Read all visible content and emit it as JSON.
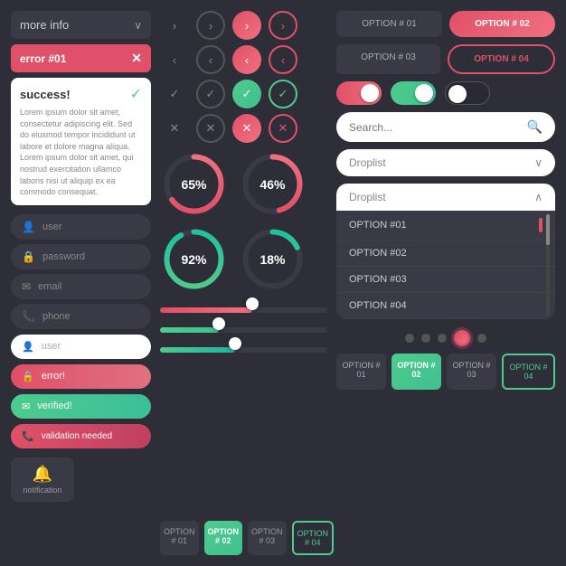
{
  "left": {
    "dropdown_label": "more info",
    "dropdown_chevron": "∨",
    "error_label": "error #01",
    "error_x": "✕",
    "success_title": "success!",
    "success_check": "✓",
    "success_text": "Lorem ipsum dolor sit amet, consectetur adipiscing elit. Sed do eiusmod tempor incididunt ut labore et dolore magna aliqua. Lorem ipsum dolor sit amet, qui nostrud exercitation ullamco laboris nisi ut aliquip ex ea commodo consequat.",
    "input_user": "user",
    "input_password": "password",
    "input_email": "email",
    "input_phone": "phone",
    "input_user2": "user",
    "input_error": "error!",
    "input_verified": "verified!",
    "input_validation": "validation needed",
    "notification_label": "notification"
  },
  "middle": {
    "chevron_right_flat": "›",
    "chevron_right_outline": "›",
    "chevron_right_pink": "›",
    "chevron_right_pink_outline": "›",
    "chevron_left_flat": "‹",
    "chevron_left_outline": "‹",
    "chevron_left_pink": "‹",
    "chevron_left_pink_outline": "‹",
    "check_flat": "✓",
    "check_outline": "✓",
    "check_green": "✓",
    "check_green_outline": "✓",
    "x_flat": "✕",
    "x_outline": "✕",
    "x_red": "✕",
    "x_red_outline": "✕",
    "progress1_pct": "65%",
    "progress2_pct": "46%",
    "progress3_pct": "92%",
    "progress4_pct": "18%",
    "progress1_val": 65,
    "progress2_val": 46,
    "progress3_val": 92,
    "progress4_val": 18,
    "slider1_pct": 55,
    "slider2_pct": 35,
    "slider3_pct": 45,
    "tab1": "OPTION # 01",
    "tab2": "OPTION # 02",
    "tab3": "OPTION # 03",
    "tab4": "OPTION # 04"
  },
  "right": {
    "option1": "OPTION # 01",
    "option2": "OPTION # 02",
    "option3": "OPTION # 03",
    "option4": "OPTION # 04",
    "search_placeholder": "Search...",
    "droplist_label": "Droplist",
    "droplist_open_label": "Droplist",
    "droplist_items": [
      "OPTION #01",
      "OPTION #02",
      "OPTION #03",
      "OPTION #04"
    ],
    "bot_option1": "OPTION # 01",
    "bot_option2": "OPTION # 02",
    "bot_option3": "OPTION # 03",
    "bot_option4": "OPTION # 04"
  }
}
